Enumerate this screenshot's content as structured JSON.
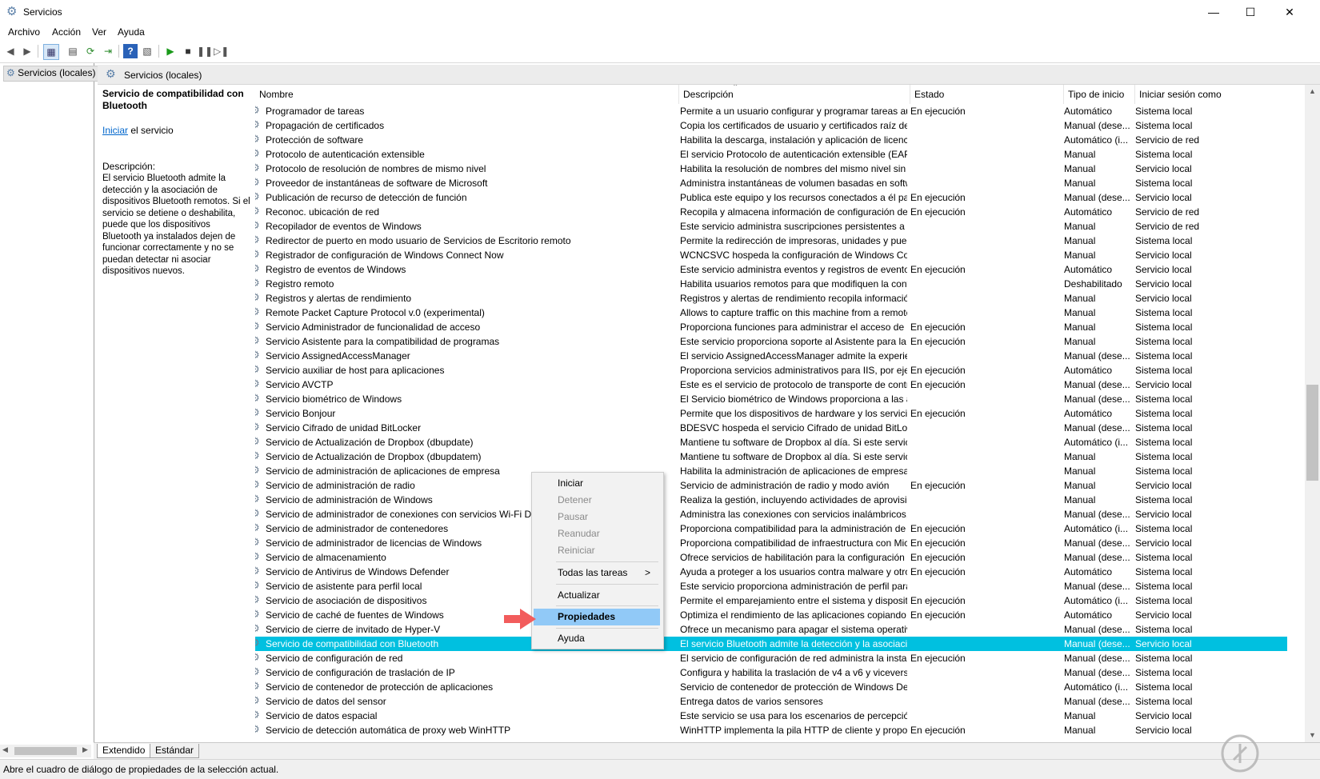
{
  "window": {
    "title": "Servicios",
    "minimize_icon": "minimize-icon",
    "maximize_icon": "maximize-icon",
    "close_icon": "close-icon"
  },
  "menu": [
    "Archivo",
    "Acción",
    "Ver",
    "Ayuda"
  ],
  "tree": {
    "root": "Servicios (locales)"
  },
  "panel_header": "Servicios (locales)",
  "desc_panel": {
    "title": "Servicio de compatibilidad con Bluetooth",
    "start_link": "Iniciar",
    "start_suffix": " el servicio",
    "desc_label": "Descripción:",
    "desc_text": "El servicio Bluetooth admite la detección y la asociación de dispositivos Bluetooth remotos. Si el servicio se detiene o deshabilita, puede que los dispositivos Bluetooth ya instalados dejen de funcionar correctamente y no se puedan detectar ni asociar dispositivos nuevos."
  },
  "columns": [
    "Nombre",
    "Descripción",
    "Estado",
    "Tipo de inicio",
    "Iniciar sesión como"
  ],
  "rows": [
    [
      "Programador de tareas",
      "Permite a un usuario configurar y programar tareas aut...",
      "En ejecución",
      "Automático",
      "Sistema local"
    ],
    [
      "Propagación de certificados",
      "Copia los certificados de usuario y certificados raíz de ta...",
      "",
      "Manual (dese...",
      "Sistema local"
    ],
    [
      "Protección de software",
      "Habilita la descarga, instalación y aplicación de licencia...",
      "",
      "Automático (i...",
      "Servicio de red"
    ],
    [
      "Protocolo de autenticación extensible",
      "El servicio Protocolo de autenticación extensible (EAP) ...",
      "",
      "Manual",
      "Sistema local"
    ],
    [
      "Protocolo de resolución de nombres de mismo nivel",
      "Habilita la resolución de nombres del mismo nivel sin s...",
      "",
      "Manual",
      "Servicio local"
    ],
    [
      "Proveedor de instantáneas de software de Microsoft",
      "Administra instantáneas de volumen basadas en softwa...",
      "",
      "Manual",
      "Sistema local"
    ],
    [
      "Publicación de recurso de detección de función",
      "Publica este equipo y los recursos conectados a él para ...",
      "En ejecución",
      "Manual (dese...",
      "Servicio local"
    ],
    [
      "Reconoc. ubicación de red",
      "Recopila y almacena información de configuración de l...",
      "En ejecución",
      "Automático",
      "Servicio de red"
    ],
    [
      "Recopilador de eventos de Windows",
      "Este servicio administra suscripciones persistentes a eve...",
      "",
      "Manual",
      "Servicio de red"
    ],
    [
      "Redirector de puerto en modo usuario de Servicios de Escritorio remoto",
      "Permite la redirección de impresoras, unidades y puerto...",
      "",
      "Manual",
      "Sistema local"
    ],
    [
      "Registrador de configuración de Windows Connect Now",
      "WCNCSVC hospeda la configuración de Windows Conn...",
      "",
      "Manual",
      "Servicio local"
    ],
    [
      "Registro de eventos de Windows",
      "Este servicio administra eventos y registros de eventos. ...",
      "En ejecución",
      "Automático",
      "Servicio local"
    ],
    [
      "Registro remoto",
      "Habilita usuarios remotos para que modifiquen la confi...",
      "",
      "Deshabilitado",
      "Servicio local"
    ],
    [
      "Registros y alertas de rendimiento",
      "Registros y alertas de rendimiento recopila información ...",
      "",
      "Manual",
      "Servicio local"
    ],
    [
      "Remote Packet Capture Protocol v.0 (experimental)",
      "Allows to capture traffic on this machine from a remote...",
      "",
      "Manual",
      "Sistema local"
    ],
    [
      "Servicio Administrador de funcionalidad de acceso",
      "Proporciona funciones para administrar el acceso de ap...",
      "En ejecución",
      "Manual",
      "Sistema local"
    ],
    [
      "Servicio Asistente para la compatibilidad de programas",
      "Este servicio proporciona soporte al Asistente para la co...",
      "En ejecución",
      "Manual",
      "Sistema local"
    ],
    [
      "Servicio AssignedAccessManager",
      "El servicio AssignedAccessManager admite la experienci...",
      "",
      "Manual (dese...",
      "Sistema local"
    ],
    [
      "Servicio auxiliar de host para aplicaciones",
      "Proporciona servicios administrativos para IIS, por ejem...",
      "En ejecución",
      "Automático",
      "Sistema local"
    ],
    [
      "Servicio AVCTP",
      "Este es el servicio de protocolo de transporte de control ...",
      "En ejecución",
      "Manual (dese...",
      "Servicio local"
    ],
    [
      "Servicio biométrico de Windows",
      "El Servicio biométrico de Windows proporciona a las ap...",
      "",
      "Manual (dese...",
      "Sistema local"
    ],
    [
      "Servicio Bonjour",
      "Permite que los dispositivos de hardware y los servicios ...",
      "En ejecución",
      "Automático",
      "Sistema local"
    ],
    [
      "Servicio Cifrado de unidad BitLocker",
      "BDESVC hospeda el servicio Cifrado de unidad BitLocke...",
      "",
      "Manual (dese...",
      "Sistema local"
    ],
    [
      "Servicio de Actualización de Dropbox (dbupdate)",
      "Mantiene tu software de Dropbox al día. Si este servicio ...",
      "",
      "Automático (i...",
      "Sistema local"
    ],
    [
      "Servicio de Actualización de Dropbox (dbupdatem)",
      "Mantiene tu software de Dropbox al día. Si este servicio ...",
      "",
      "Manual",
      "Sistema local"
    ],
    [
      "Servicio de administración de aplicaciones de empresa",
      "Habilita la administración de aplicaciones de empresa.",
      "",
      "Manual",
      "Sistema local"
    ],
    [
      "Servicio de administración de radio",
      "Servicio de administración de radio y modo avión",
      "En ejecución",
      "Manual",
      "Servicio local"
    ],
    [
      "Servicio de administración de Windows",
      "Realiza la gestión, incluyendo actividades de aprovision...",
      "",
      "Manual",
      "Sistema local"
    ],
    [
      "Servicio de administrador de conexiones con servicios Wi-Fi Di...",
      "Administra las conexiones con servicios inalámbricos, i...",
      "",
      "Manual (dese...",
      "Servicio local"
    ],
    [
      "Servicio de administrador de contenedores",
      "Proporciona compatibilidad para la administración de c...",
      "En ejecución",
      "Automático (i...",
      "Sistema local"
    ],
    [
      "Servicio de administrador de licencias de Windows",
      "Proporciona compatibilidad de infraestructura con Micr...",
      "En ejecución",
      "Manual (dese...",
      "Servicio local"
    ],
    [
      "Servicio de almacenamiento",
      "Ofrece servicios de habilitación para la configuración d...",
      "En ejecución",
      "Manual (dese...",
      "Sistema local"
    ],
    [
      "Servicio de Antivirus de Windows Defender",
      "Ayuda a proteger a los usuarios contra malware y otro s...",
      "En ejecución",
      "Automático",
      "Sistema local"
    ],
    [
      "Servicio de asistente para perfil local",
      "Este servicio proporciona administración de perfil para ...",
      "",
      "Manual (dese...",
      "Sistema local"
    ],
    [
      "Servicio de asociación de dispositivos",
      "Permite el emparejamiento entre el sistema y dispositiv...",
      "En ejecución",
      "Automático (i...",
      "Sistema local"
    ],
    [
      "Servicio de caché de fuentes de Windows",
      "Optimiza el rendimiento de las aplicaciones copiando e...",
      "En ejecución",
      "Automático",
      "Servicio local"
    ],
    [
      "Servicio de cierre de invitado de Hyper-V",
      "Ofrece un mecanismo para apagar el sistema operativo ...",
      "",
      "Manual (dese...",
      "Sistema local"
    ],
    [
      "Servicio de compatibilidad con Bluetooth",
      "El servicio Bluetooth admite la detección y la asociación...",
      "",
      "Manual (dese...",
      "Servicio local"
    ],
    [
      "Servicio de configuración de red",
      "El servicio de configuración de red administra la instala...",
      "En ejecución",
      "Manual (dese...",
      "Sistema local"
    ],
    [
      "Servicio de configuración de traslación de IP",
      "Configura y habilita la traslación de v4 a v6 y viceversa",
      "",
      "Manual (dese...",
      "Sistema local"
    ],
    [
      "Servicio de contenedor de protección de aplicaciones",
      "Servicio de contenedor de protección de Windows Defe...",
      "",
      "Automático (i...",
      "Sistema local"
    ],
    [
      "Servicio de datos del sensor",
      "Entrega datos de varios sensores",
      "",
      "Manual (dese...",
      "Sistema local"
    ],
    [
      "Servicio de datos espacial",
      "Este servicio se usa para los escenarios de percepción es...",
      "",
      "Manual",
      "Servicio local"
    ],
    [
      "Servicio de detección automática de proxy web WinHTTP",
      "WinHTTP implementa la pila HTTP de cliente y proporc...",
      "En ejecución",
      "Manual",
      "Servicio local"
    ]
  ],
  "selected_row": 37,
  "context_menu": {
    "items": [
      "Iniciar",
      "Detener",
      "Pausar",
      "Reanudar",
      "Reiniciar",
      "Todas las tareas",
      "Actualizar",
      "Propiedades",
      "Ayuda"
    ],
    "disabled": [
      false,
      true,
      true,
      true,
      true,
      false,
      false,
      false,
      false
    ],
    "submenu_arrow": ">"
  },
  "tabs": [
    "Extendido",
    "Estándar"
  ],
  "status": "Abre el cuadro de diálogo de propiedades de la selección actual.",
  "colors": {
    "selection": "#00c0e0",
    "menu_highlight": "#91c9f7",
    "arrow": "#f25c5c"
  }
}
